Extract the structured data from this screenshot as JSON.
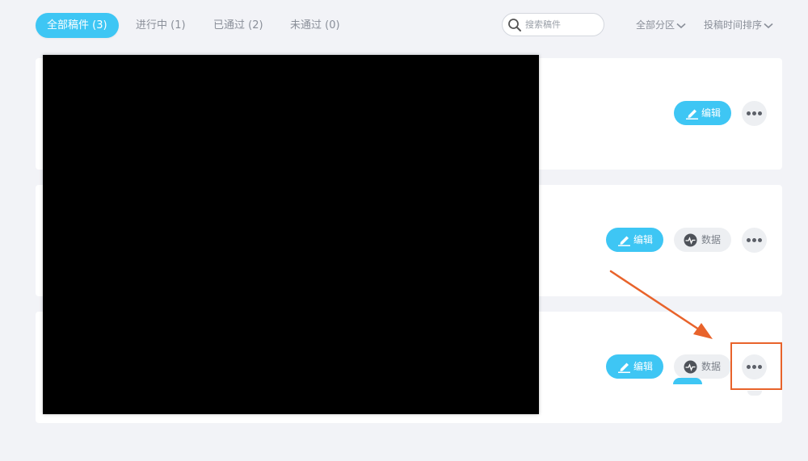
{
  "tabs": [
    {
      "label": "全部稿件 (3)",
      "active": true
    },
    {
      "label": "进行中 (1)",
      "active": false
    },
    {
      "label": "已通过 (2)",
      "active": false
    },
    {
      "label": "未通过 (0)",
      "active": false
    }
  ],
  "search": {
    "placeholder": "搜索稿件",
    "value": ""
  },
  "filters": {
    "section": "全部分区",
    "sort": "投稿时间排序"
  },
  "cards": [
    {
      "edit_label": "编辑"
    },
    {
      "edit_label": "编辑",
      "data_label": "数据"
    },
    {
      "edit_label": "编辑",
      "data_label": "数据"
    }
  ],
  "colors": {
    "accent": "#3ec6f4",
    "background": "#f2f3f7",
    "annotation": "#e8632b",
    "redaction": "#000000"
  },
  "icons": {
    "search": "search-icon",
    "chevron": "chevron-down-icon",
    "edit": "pencil-icon",
    "data": "pulse-chart-icon",
    "more": "more-horizontal-icon"
  }
}
